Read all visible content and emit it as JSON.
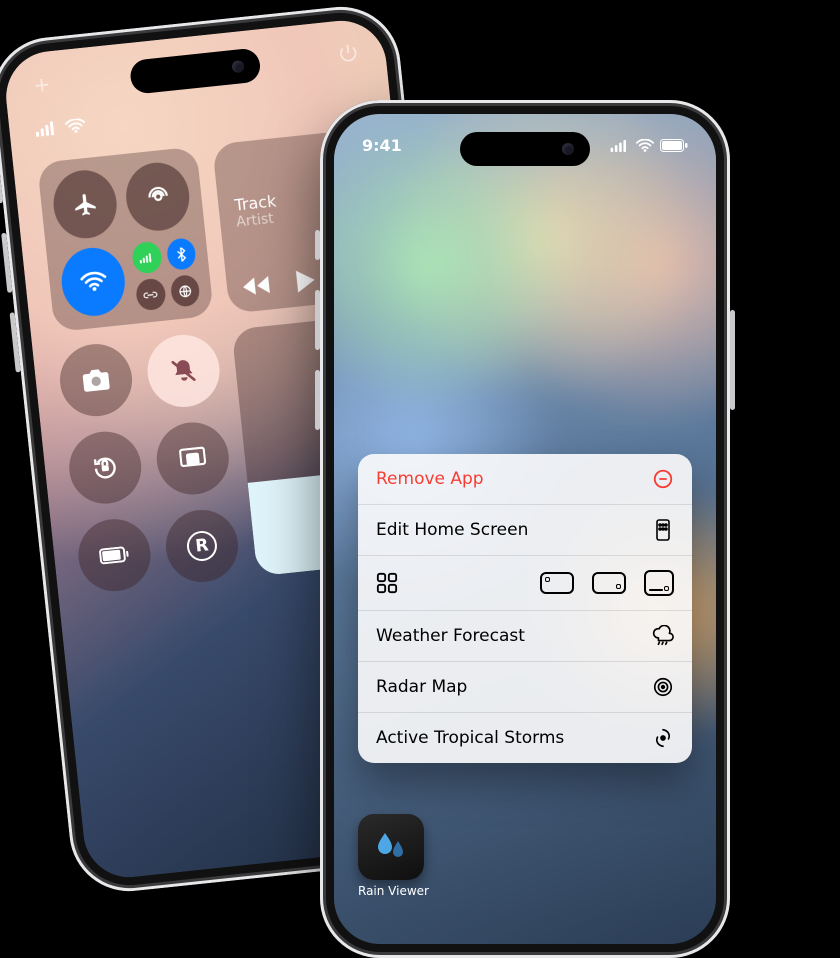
{
  "phone_a": {
    "top_add_icon": "plus",
    "top_power_icon": "power",
    "status": {
      "cellular_bars": 4,
      "wifi": true
    },
    "connectivity": {
      "airplane": false,
      "airdrop": false,
      "wifi": true,
      "cellular": true,
      "bluetooth": true,
      "hotspot": false,
      "vpn": false
    },
    "media": {
      "track_label": "Track",
      "artist_label": "Artist"
    },
    "brightness_percent": 38,
    "round_buttons": [
      {
        "name": "camera",
        "light": false
      },
      {
        "name": "silent-mode",
        "light": true
      },
      {
        "name": "rotation-lock",
        "light": false
      },
      {
        "name": "screen-mirroring",
        "light": false
      },
      {
        "name": "low-power",
        "light": false
      },
      {
        "name": "r-shortcut",
        "light": false
      }
    ]
  },
  "phone_b": {
    "status_time": "9:41",
    "context_menu": {
      "remove_label": "Remove App",
      "edit_label": "Edit Home Screen",
      "forecast_label": "Weather Forecast",
      "radar_label": "Radar Map",
      "storms_label": "Active Tropical Storms"
    },
    "app": {
      "name": "Rain Viewer"
    }
  }
}
